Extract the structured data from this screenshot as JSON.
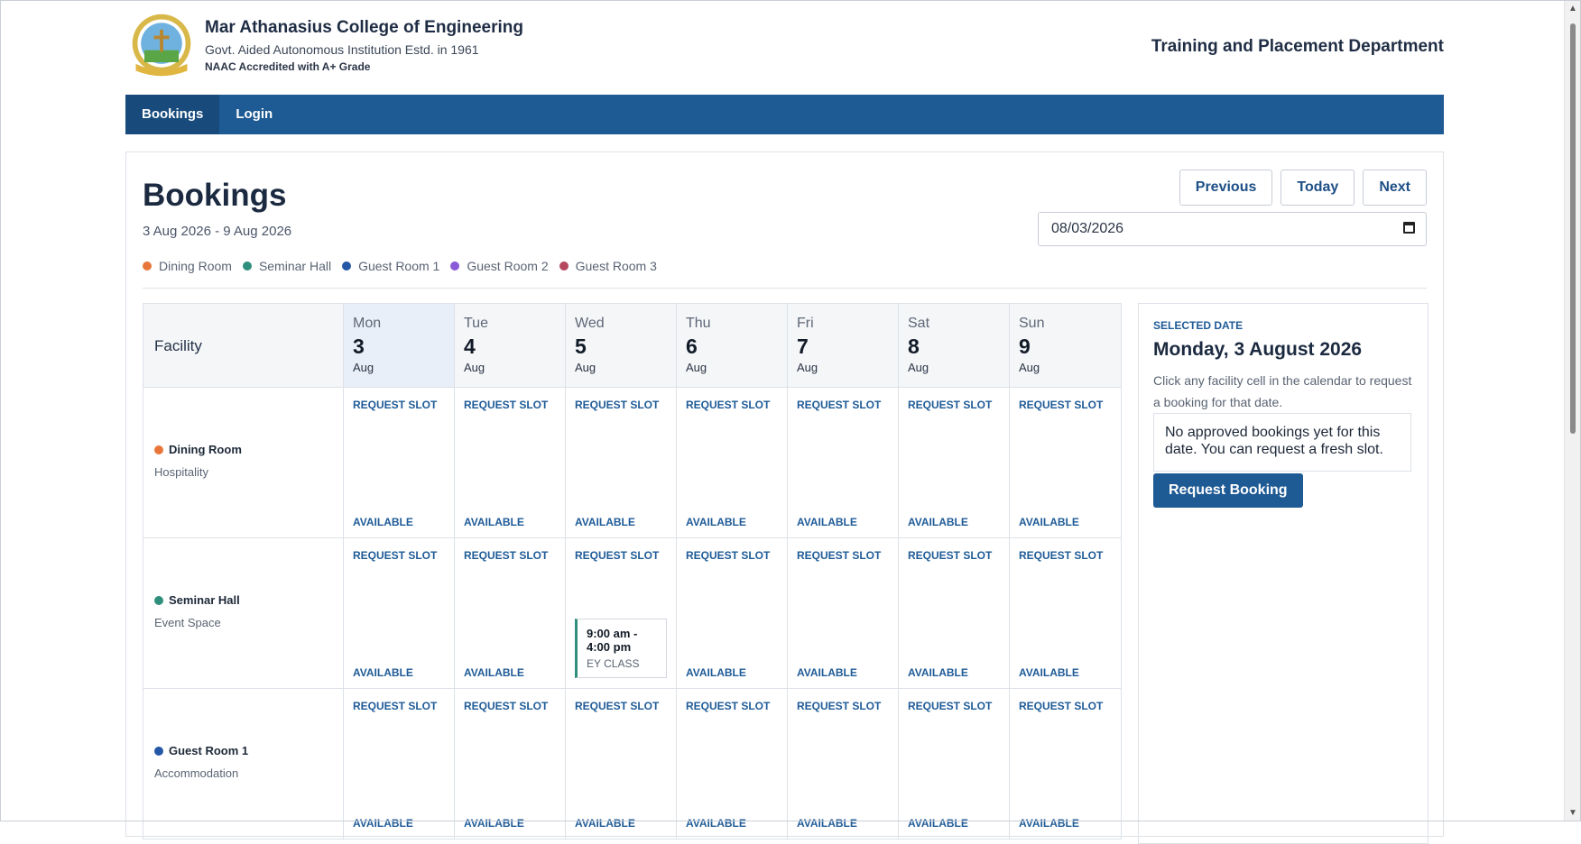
{
  "header": {
    "college_name": "Mar Athanasius College of Engineering",
    "subtitle": "Govt. Aided Autonomous Institution Estd. in 1961",
    "accreditation": "NAAC Accredited with A+ Grade",
    "department": "Training and Placement Department"
  },
  "nav": {
    "items": [
      {
        "label": "Bookings"
      },
      {
        "label": "Login"
      }
    ]
  },
  "page": {
    "title": "Bookings",
    "range": "3 Aug 2026 - 9 Aug 2026",
    "prev_label": "Previous",
    "today_label": "Today",
    "next_label": "Next",
    "date_value": "08/03/2026"
  },
  "legend": [
    {
      "label": "Dining Room",
      "color": "#e8763a"
    },
    {
      "label": "Seminar Hall",
      "color": "#2f8f7c"
    },
    {
      "label": "Guest Room 1",
      "color": "#2457a6"
    },
    {
      "label": "Guest Room 2",
      "color": "#8a5bd6"
    },
    {
      "label": "Guest Room 3",
      "color": "#b5485f"
    }
  ],
  "calendar": {
    "facility_header": "Facility",
    "days": [
      {
        "dow": "Mon",
        "num": "3",
        "mon": "Aug"
      },
      {
        "dow": "Tue",
        "num": "4",
        "mon": "Aug"
      },
      {
        "dow": "Wed",
        "num": "5",
        "mon": "Aug"
      },
      {
        "dow": "Thu",
        "num": "6",
        "mon": "Aug"
      },
      {
        "dow": "Fri",
        "num": "7",
        "mon": "Aug"
      },
      {
        "dow": "Sat",
        "num": "8",
        "mon": "Aug"
      },
      {
        "dow": "Sun",
        "num": "9",
        "mon": "Aug"
      }
    ],
    "request_label": "REQUEST SLOT",
    "available_label": "AVAILABLE",
    "facilities": [
      {
        "name": "Dining Room",
        "type": "Hospitality",
        "color": "#e8763a"
      },
      {
        "name": "Seminar Hall",
        "type": "Event Space",
        "color": "#2f8f7c"
      },
      {
        "name": "Guest Room 1",
        "type": "Accommodation",
        "color": "#2457a6"
      }
    ],
    "event": {
      "time": "9:00 am - 4:00 pm",
      "name": "EY CLASS"
    }
  },
  "side": {
    "label": "SELECTED DATE",
    "date": "Monday, 3 August 2026",
    "help": "Click any facility cell in the calendar to request a booking for that date.",
    "note": "No approved bookings yet for this date. You can request a fresh slot.",
    "button": "Request Booking"
  }
}
